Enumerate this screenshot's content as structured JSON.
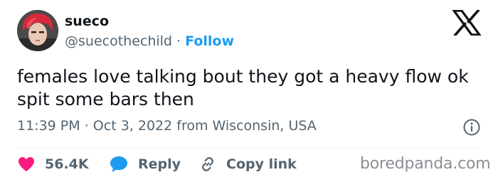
{
  "author": {
    "name": "sueco",
    "handle": "@suecothechild",
    "separator": "·",
    "follow_label": "Follow"
  },
  "tweet": {
    "text": "females love talking bout they got a heavy flow ok spit some bars then",
    "time": "11:39 PM",
    "meta_sep": "·",
    "date": "Oct 3, 2022",
    "location": "from Wisconsin, USA"
  },
  "actions": {
    "likes": "56.4K",
    "reply_label": "Reply",
    "copy_label": "Copy link"
  },
  "watermark": "boredpanda.com",
  "icons": {
    "platform": "x-logo-icon",
    "info": "info-icon",
    "like": "heart-icon",
    "reply": "speech-bubble-icon",
    "copy": "link-icon"
  },
  "colors": {
    "accent": "#1d9bf0",
    "like": "#f91880",
    "secondary_text": "#536471",
    "primary_text": "#0f1419",
    "avatar_hair": "#d62a3a"
  }
}
